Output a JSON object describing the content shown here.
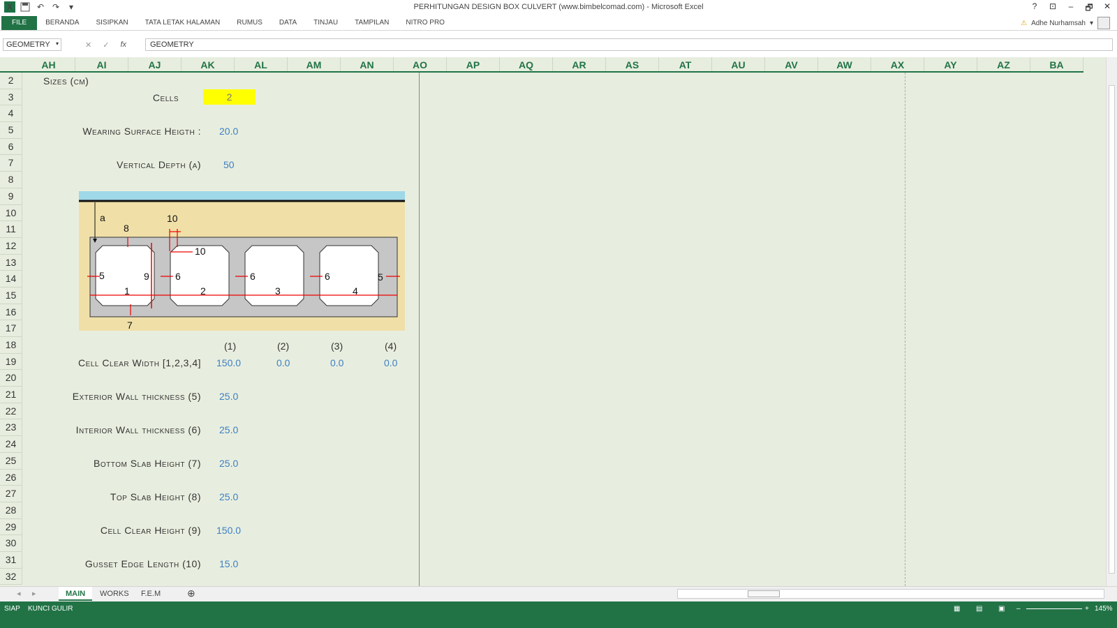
{
  "window": {
    "title": "PERHITUNGAN DESIGN BOX CULVERT (www.bimbelcomad.com) - Microsoft Excel",
    "controls": [
      "?",
      "⊡",
      "–",
      "🗗",
      "✕"
    ]
  },
  "ribbon": {
    "tabs": [
      "FILE",
      "BERANDA",
      "SISIPKAN",
      "TATA LETAK HALAMAN",
      "RUMUS",
      "DATA",
      "TINJAU",
      "TAMPILAN",
      "NITRO PRO"
    ],
    "user": "Adhe Nurhamsah"
  },
  "formula_bar": {
    "name_box": "GEOMETRY",
    "content": "GEOMETRY"
  },
  "columns": [
    "AH",
    "AI",
    "AJ",
    "AK",
    "AL",
    "AM",
    "AN",
    "AO",
    "AP",
    "AQ",
    "AR",
    "AS",
    "AT",
    "AU",
    "AV",
    "AW",
    "AX",
    "AY",
    "AZ",
    "BA"
  ],
  "rows": [
    "2",
    "3",
    "4",
    "5",
    "6",
    "7",
    "8",
    "9",
    "10",
    "11",
    "12",
    "13",
    "14",
    "15",
    "16",
    "17",
    "18",
    "19",
    "20",
    "21",
    "22",
    "23",
    "24",
    "25",
    "26",
    "27",
    "28",
    "29",
    "30",
    "31",
    "32"
  ],
  "sheet": {
    "sizes_label": "Sizes (cm)",
    "cells_label": "Cells",
    "cells_value": "2",
    "wearing_label": "Wearing Surface Heigth :",
    "wearing_value": "20.0",
    "vdepth_label": "Vertical Depth (a)",
    "vdepth_value": "50",
    "col_headers": [
      "(1)",
      "(2)",
      "(3)",
      "(4)"
    ],
    "ccw_label": "Cell Clear Width [1,2,3,4]",
    "ccw_values": [
      "150.0",
      "0.0",
      "0.0",
      "0.0"
    ],
    "ewt_label": "Exterior Wall thickness (5)",
    "ewt_value": "25.0",
    "iwt_label": "Interior Wall thickness (6)",
    "iwt_value": "25.0",
    "bsh_label": "Bottom Slab Height (7)",
    "bsh_value": "25.0",
    "tsh_label": "Top Slab Height (8)",
    "tsh_value": "25.0",
    "cch_label": "Cell Clear Height (9)",
    "cch_value": "150.0",
    "gel_label": "Gusset Edge Length (10)",
    "gel_value": "15.0"
  },
  "diagram": {
    "labels": [
      "a",
      "8",
      "10",
      "10",
      "5",
      "9",
      "6",
      "6",
      "6",
      "5",
      "1",
      "2",
      "3",
      "4",
      "7"
    ]
  },
  "sheet_tabs": [
    "MAIN",
    "WORKS",
    "F.E.M"
  ],
  "status": {
    "ready": "SIAP",
    "scroll_lock": "KUNCI GULIR",
    "zoom": "145%"
  },
  "colors": {
    "excel_green": "#217346",
    "sheet_bg": "#e8eedf",
    "value_blue": "#3d7fc4",
    "highlight_yellow": "#ffff00"
  }
}
